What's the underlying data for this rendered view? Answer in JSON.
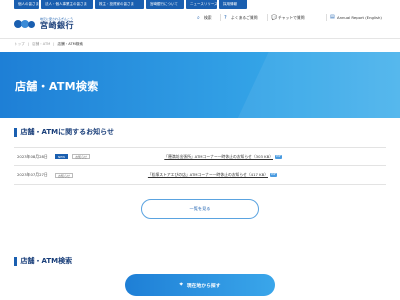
{
  "top_tabs": [
    "個人の皆さま",
    "法人・個人事業主の皆さま",
    "株主・投資家の皆さま",
    "宮崎銀行について",
    "ニュースリリース",
    "採用情報"
  ],
  "header": {
    "logo_sub": "地元に愛されるぎんこう",
    "logo_name": "宮崎銀行",
    "utility": [
      {
        "icon": "search-icon",
        "glyph": "⌕",
        "label": "検索"
      },
      {
        "icon": "question-icon",
        "glyph": "?",
        "label": "よくあるご質問"
      },
      {
        "icon": "chat-icon",
        "glyph": "💬",
        "label": "チャットで質問"
      },
      {
        "icon": "document-icon",
        "glyph": "▤",
        "label": "Annual Report (English)"
      }
    ]
  },
  "breadcrumb": {
    "home": "トップ",
    "parent": "店舗・ATM",
    "current": "店舗・ATM検索"
  },
  "hero": {
    "title": "店舗・ATM検索"
  },
  "sections": {
    "notice_title": "店舗・ATMに関するお知らせ",
    "search_title": "店舗・ATM検索"
  },
  "news": [
    {
      "date": "2023年08月28日",
      "badge": "NEW",
      "category": "お知らせ",
      "link": "「穂満坊出張所」ATMコーナー一時休止のお知らせ（303 KB）",
      "file_type": "PDF"
    },
    {
      "date": "2023年07月27日",
      "badge": "",
      "category": "お知らせ",
      "link": "「松塚ストアエびの店」ATMコーナー一時休止のお知らせ（417 KB）",
      "file_type": "PDF"
    }
  ],
  "buttons": {
    "more": "一覧を見る",
    "locate": "現在地から探す",
    "locate_icon": "location-pin-icon"
  },
  "colors": {
    "brand": "#1a5fb0",
    "hero_start": "#1e7fd6",
    "hero_end": "#4ab3ec"
  }
}
